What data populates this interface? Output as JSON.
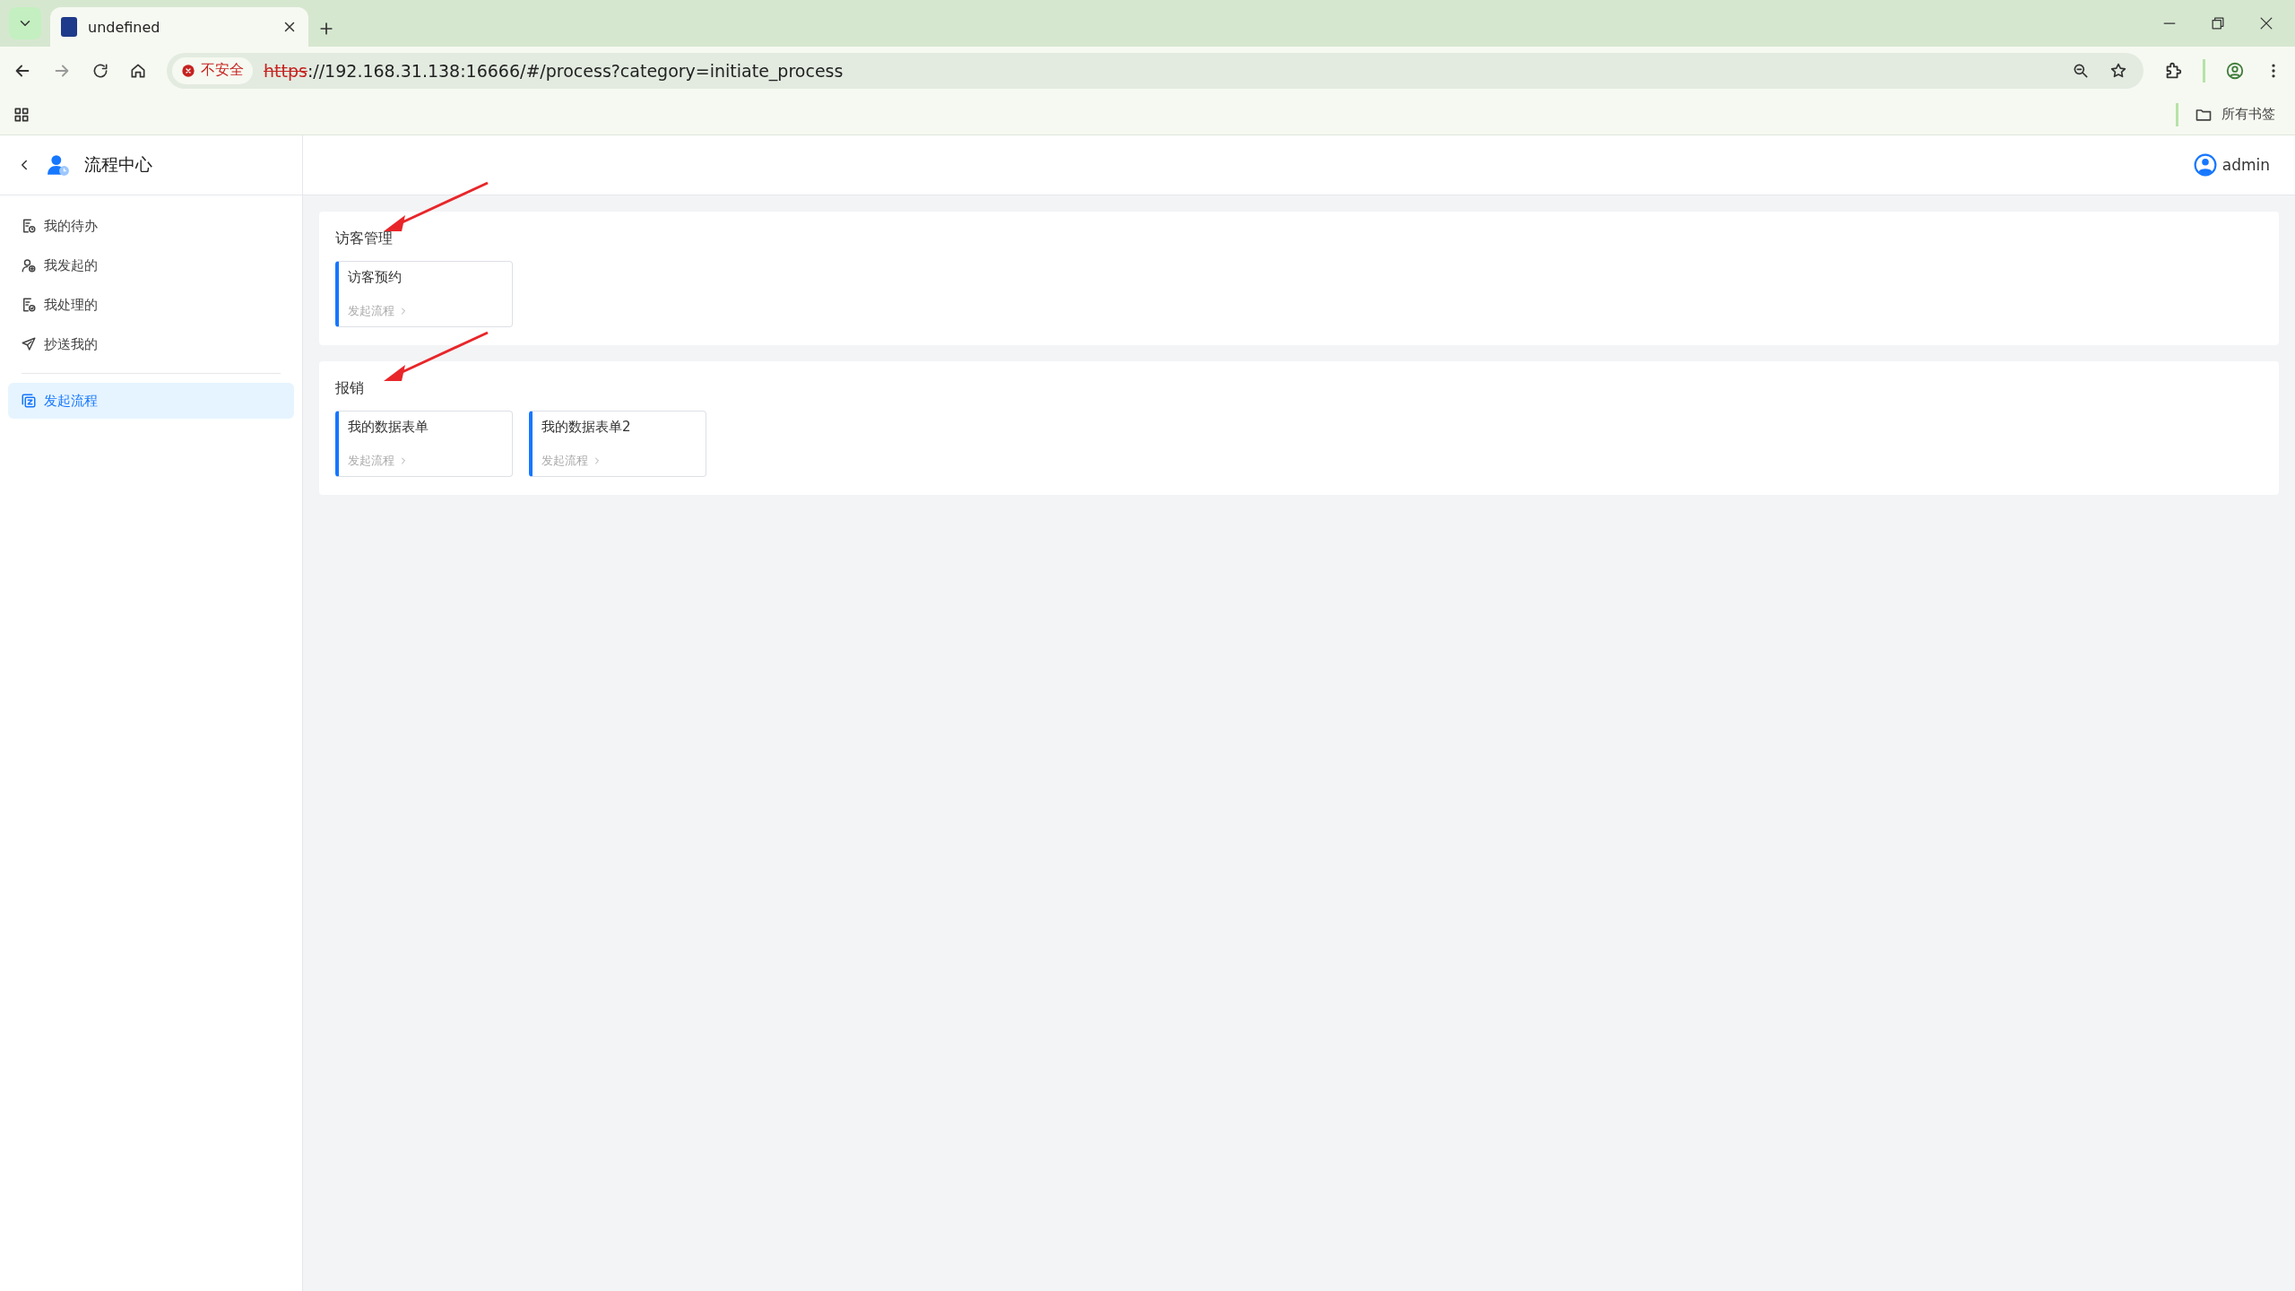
{
  "browser": {
    "tab": {
      "title": "undefined"
    },
    "security": "不安全",
    "url": {
      "scheme": "https",
      "rest": "://192.168.31.138:16666/#/process?category=initiate_process"
    },
    "bookmarks": "所有书签"
  },
  "app": {
    "title": "流程中心",
    "user": "admin"
  },
  "sidebar": {
    "groups": [
      [
        {
          "label": "我的待办",
          "kind": "todo",
          "selected": false
        },
        {
          "label": "我发起的",
          "kind": "started",
          "selected": false
        },
        {
          "label": "我处理的",
          "kind": "handled",
          "selected": false
        },
        {
          "label": "抄送我的",
          "kind": "cc",
          "selected": false
        }
      ],
      [
        {
          "label": "发起流程",
          "kind": "initiate",
          "selected": true
        }
      ]
    ]
  },
  "sections": [
    {
      "title": "访客管理",
      "arrow": true,
      "forms": [
        {
          "name": "访客预约",
          "action": "发起流程"
        }
      ]
    },
    {
      "title": "报销",
      "arrow": true,
      "forms": [
        {
          "name": "我的数据表单",
          "action": "发起流程"
        },
        {
          "name": "我的数据表单2",
          "action": "发起流程"
        }
      ]
    }
  ]
}
